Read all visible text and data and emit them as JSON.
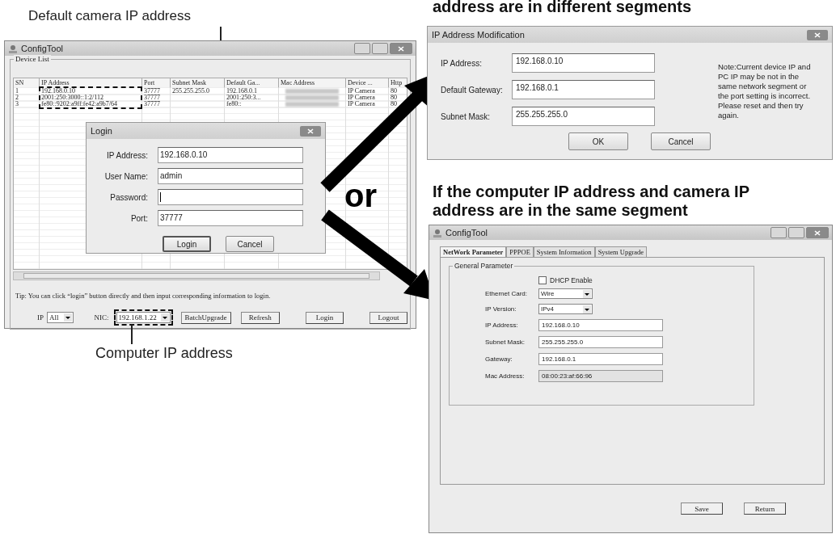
{
  "annotations": {
    "camera_ip_caption": "Default camera IP address",
    "computer_ip_caption": "Computer IP address",
    "or_label": "or"
  },
  "device_window": {
    "title": "ConfigTool",
    "group_title": "Device List",
    "columns": [
      "SN",
      "IP Address",
      "Port",
      "Subnet Mask",
      "Default Ga...",
      "Mac Address",
      "Device ...",
      "Http"
    ],
    "rows": [
      {
        "sn": "1",
        "ip": "192.168.0.10",
        "port": "37777",
        "mask": "255.255.255.0",
        "gateway": "192.168.0.1",
        "mac_blurred": true,
        "device": "IP Camera",
        "http": "80"
      },
      {
        "sn": "2",
        "ip": "2001:250:3000::1:2/112",
        "port": "37777",
        "gateway": "2001:250:3...",
        "mac_blurred": true,
        "device": "IP Camera",
        "http": "80"
      },
      {
        "sn": "3",
        "ip": "fe80::9202:a9ff:fe42:a9b7/64",
        "port": "37777",
        "gateway": "fe80::",
        "mac_blurred": true,
        "device": "IP Camera",
        "http": "80"
      }
    ],
    "tip": "Tip: You can click “login” button directly and then input corresponding information to login.",
    "ip_label": "IP",
    "ip_filter": "All",
    "nic_label": "NIC:",
    "nic_value": "192.168.1.22",
    "buttons": [
      "BatchUpgrade",
      "Refresh",
      "Login",
      "Logout"
    ]
  },
  "login_dialog": {
    "title": "Login",
    "fields": [
      {
        "label": "IP Address:",
        "value": "192.168.0.10"
      },
      {
        "label": "User Name:",
        "value": "admin"
      },
      {
        "label": "Password:",
        "focused": true
      },
      {
        "label": "Port:",
        "value": "37777"
      }
    ],
    "buttons": [
      "Login",
      "Cancel"
    ]
  },
  "heading_different": "address are in different segments",
  "modify_dialog": {
    "title": "IP Address Modification",
    "fields": [
      {
        "label": "IP Address:",
        "value": "192.168.0.10"
      },
      {
        "label": "Default Gateway:",
        "value": "192.168.0.1"
      },
      {
        "label": "Subnet Mask:",
        "value": "255.255.255.0"
      }
    ],
    "note": "Note:Current device IP and PC IP may be not in the same network segment or the port setting is incorrect. Please reset and then try again.",
    "buttons": [
      "OK",
      "Cancel"
    ]
  },
  "heading_same": "If the computer IP address and camera IP address are in the same segment",
  "config_window": {
    "title": "ConfigTool",
    "tabs": [
      {
        "label": "NetWork Parameter",
        "selected": true
      },
      {
        "label": "PPPOE",
        "selected": false
      },
      {
        "label": "System Information",
        "selected": false
      },
      {
        "label": "System Upgrade",
        "selected": false
      }
    ],
    "group_title": "General Parameter",
    "dhcp": {
      "label": "DHCP Enable",
      "checked": false
    },
    "fields": [
      {
        "kind": "select",
        "label": "Ethernet Card:",
        "value": "Wire"
      },
      {
        "kind": "select",
        "label": "IP Version:",
        "value": "IPv4"
      },
      {
        "kind": "text",
        "label": "IP Address:",
        "value": "192.168.0.10"
      },
      {
        "kind": "text",
        "label": "Subnet Mask:",
        "value": "255.255.255.0"
      },
      {
        "kind": "text",
        "label": "Gateway:",
        "value": "192.168.0.1"
      },
      {
        "kind": "readonly",
        "label": "Mac Address:",
        "value": "08:00:23:af:66:96"
      }
    ],
    "buttons": [
      "Save",
      "Return"
    ]
  }
}
